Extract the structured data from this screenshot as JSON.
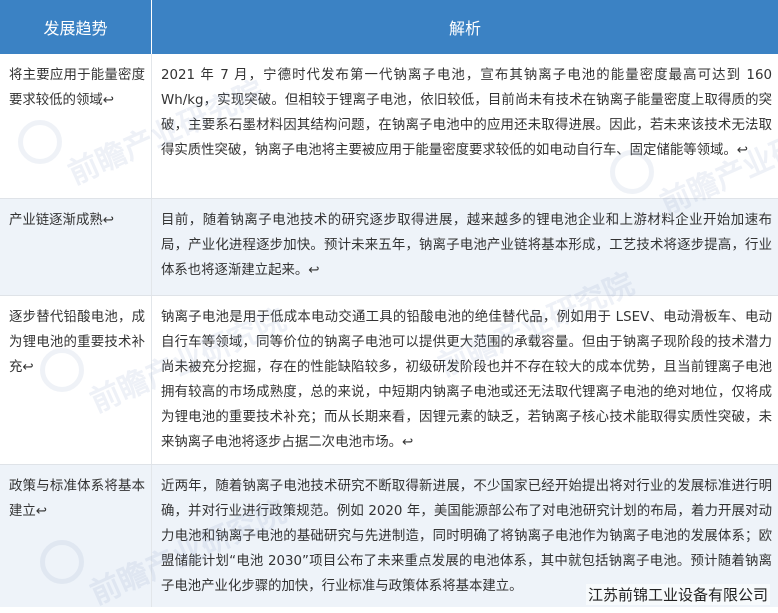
{
  "header": {
    "col1": "发展趋势",
    "col2": "解析"
  },
  "rows": [
    {
      "trend": "将主要应用于能量密度要求较低的领域↩",
      "analysis": "2021 年 7 月，宁德时代发布第一代钠离子电池，宣布其钠离子电池的能量密度最高可达到 160 Wh/kg，实现突破。但相较于锂离子电池，依旧较低，目前尚未有技术在钠离子能量密度上取得质的突破，主要系石墨材料因其结构问题，在钠离子电池中的应用还未取得进展。因此，若未来该技术无法取得实质性突破，钠离子电池将主要被应用于能量密度要求较低的如电动自行车、固定储能等领域。↩"
    },
    {
      "trend": "产业链逐渐成熟↩",
      "analysis": "目前，随着钠离子电池技术的研究逐步取得进展，越来越多的锂电池企业和上游材料企业开始加速布局，产业化进程逐步加快。预计未来五年，钠离子电池产业链将基本形成，工艺技术将逐步提高，行业体系也将逐渐建立起来。↩"
    },
    {
      "trend": "逐步替代铅酸电池，成为锂电池的重要技术补充↩",
      "analysis": "钠离子电池是用于低成本电动交通工具的铅酸电池的绝佳替代品，例如用于 LSEV、电动滑板车、电动自行车等领域，同等价位的钠离子电池可以提供更大范围的承载容量。但由于钠离子现阶段的技术潜力尚未被充分挖掘，存在的性能缺陷较多，初级研发阶段也并不存在较大的成本优势，且当前锂离子电池拥有较高的市场成熟度，总的来说，中短期内钠离子电池或还无法取代锂离子电池的绝对地位，仅将成为锂电池的重要技术补充；而从长期来看，因锂元素的缺乏，若钠离子核心技术能取得实质性突破，未来钠离子电池将逐步占据二次电池市场。↩"
    },
    {
      "trend": "政策与标准体系将基本建立↩",
      "analysis": "近两年，随着钠离子电池技术研究不断取得新进展，不少国家已经开始提出将对行业的发展标准进行明确，并对行业进行政策规范。例如 2020 年，美国能源部公布了对电池研究计划的布局，着力开展对动力电池和钠离子电池的基础研究与先进制造，同时明确了将钠离子电池作为钠离子电池的发展体系；欧盟储能计划“电池 2030”项目公布了未来重点发展的电池体系，其中就包括钠离子电池。预计随着钠离子电池产业化步骤的加快，行业标准与政策体系将基本建立。"
    }
  ],
  "watermark": {
    "brand": "前瞻产业研究院",
    "source": "江苏前锦工业设备有限公司"
  }
}
